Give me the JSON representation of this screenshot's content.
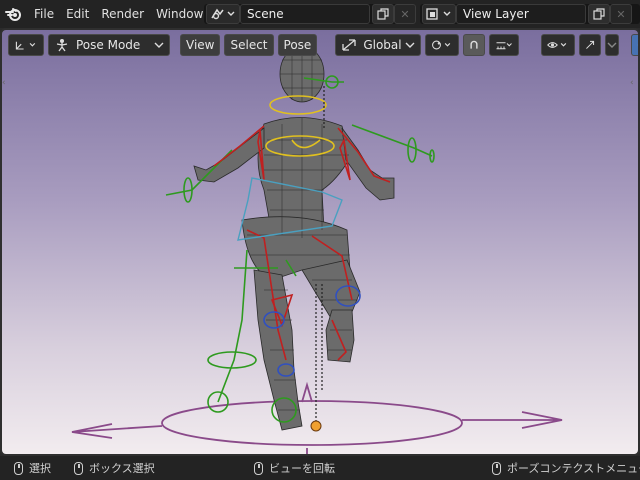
{
  "topbar": {
    "menus": [
      "File",
      "Edit",
      "Render",
      "Window"
    ],
    "scene_value": "Scene",
    "view_layer_value": "View Layer"
  },
  "viewport_header": {
    "mode_label": "Pose Mode",
    "view_label": "View",
    "select_label": "Select",
    "pose_label": "Pose",
    "orientation_label": "Global"
  },
  "status_bar": {
    "select_label": "選択",
    "box_select_label": "ボックス選択",
    "rotate_view_label": "ビューを回転",
    "context_menu_label": "ポーズコンテクストメニュー"
  },
  "colors": {
    "bone_green": "#2e9a1f",
    "bone_red": "#c02020",
    "bone_yellow": "#e0c020",
    "bone_blue": "#3050c0",
    "bone_cyan": "#4aa0c0",
    "root_purple": "#8a4a8a",
    "mesh_gray": "#6e6e6e"
  }
}
